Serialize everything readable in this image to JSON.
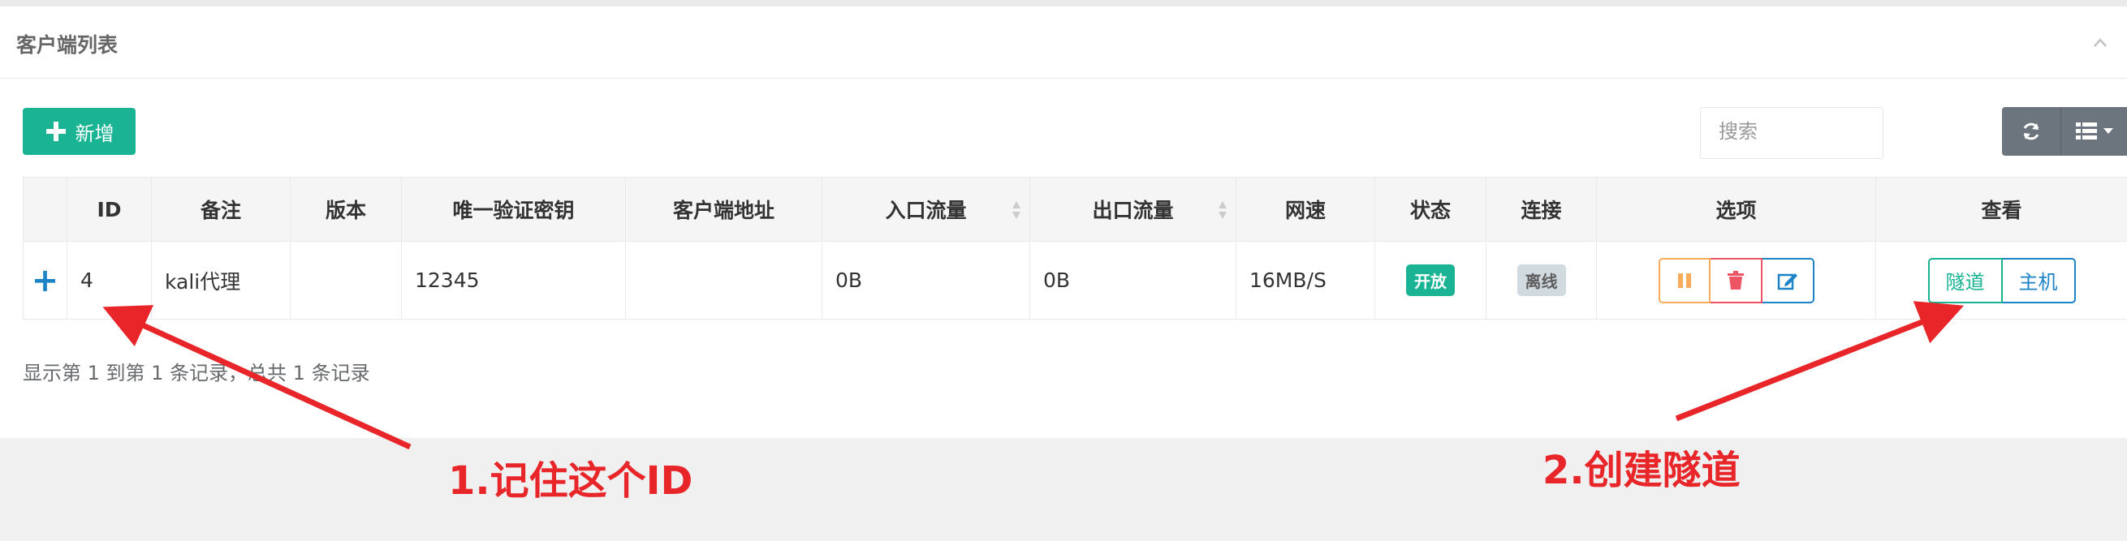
{
  "panel": {
    "title": "客户端列表"
  },
  "toolbar": {
    "add_label": "新增",
    "search_placeholder": "搜索"
  },
  "table": {
    "headers": [
      "ID",
      "备注",
      "版本",
      "唯一验证密钥",
      "客户端地址",
      "入口流量",
      "出口流量",
      "网速",
      "状态",
      "连接",
      "选项",
      "查看"
    ],
    "rows": [
      {
        "expand": "+",
        "id": "4",
        "remark": "kali代理",
        "version": "",
        "key": "12345",
        "address": "",
        "in_traffic": "0B",
        "out_traffic": "0B",
        "speed": "16MB/S",
        "status": "开放",
        "connection": "离线",
        "view_tunnel": "隧道",
        "view_host": "主机"
      }
    ]
  },
  "pagination": {
    "info": "显示第 1 到第 1 条记录，总共 1 条记录"
  },
  "annotations": {
    "note1": "1.记住这个ID",
    "note2": "2.创建隧道"
  },
  "colors": {
    "primary": "#1ab394",
    "danger": "#ed5565",
    "warning": "#f8ac59",
    "annotation_red": "#e8262a"
  }
}
